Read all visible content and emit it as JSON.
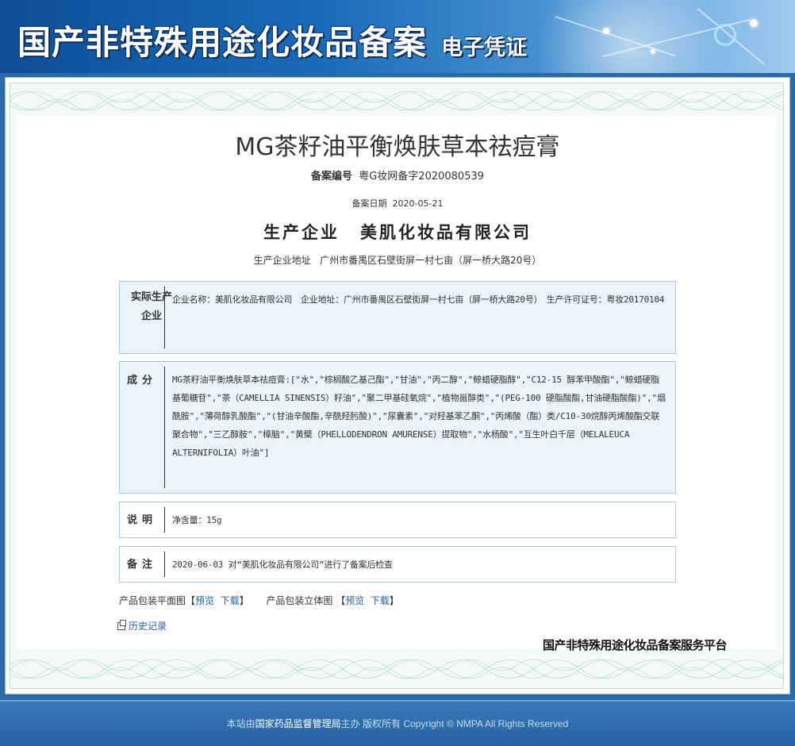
{
  "banner": {
    "title": "国产非特殊用途化妆品备案",
    "subtitle": "电子凭证"
  },
  "product": {
    "title": "MG茶籽油平衡焕肤草本祛痘膏",
    "reg_label": "备案编号",
    "reg_no": "粤G妆网备字2020080539",
    "date_label": "备案日期",
    "date": "2020-05-21",
    "company_label": "生产企业",
    "company": "美肌化妆品有限公司",
    "address_label": "生产企业地址",
    "address": "广州市番禺区石壁街屏一村七亩（屏一桥大路20号）"
  },
  "boxes": {
    "producer": {
      "label": "实际生产企业",
      "text": "企业名称：美肌化妆品有限公司　企业地址：广州市番禺区石壁街屏一村七亩（屏一桥大路20号）　生产许可证号：粤妆20170104"
    },
    "ingredients": {
      "label": "成分",
      "text": "MG茶籽油平衡焕肤草本祛痘膏:[\"水\",\"棕榈酸乙基己酯\",\"甘油\",\"丙二醇\",\"鲸蜡硬脂醇\",\"C12-15 醇苯甲酸酯\",\"鲸蜡硬脂基葡糖苷\",\"茶（CAMELLIA SINENSIS）籽油\",\"聚二甲基硅氧烷\",\"植物甾醇类\",\"(PEG-100 硬脂酸酯,甘油硬脂酸酯)\",\"烟酰胺\",\"薄荷醇乳酸酯\",\"(甘油辛酸酯,辛酰羟肟酸)\",\"尿囊素\",\"对羟基苯乙酮\",\"丙烯酸（酯）类/C10-30烷醇丙烯酸酯交联聚合物\",\"三乙醇胺\",\"樟脑\",\"黄檗（PHELLODENDRON AMURENSE）提取物\",\"水杨酸\",\"互生叶白千层（MELALEUCA ALTERNIFOLIA）叶油\"]"
    },
    "note": {
      "label": "说明",
      "text": "净含量：15g"
    },
    "remark": {
      "label": "备注",
      "text": "2020-06-03 对“美肌化妆品有限公司”进行了备案后检查"
    }
  },
  "links": {
    "flat_label": "产品包装平面图",
    "stereo_label": "产品包装立体图",
    "open_bracket": "【",
    "close_bracket": "】",
    "preview": "预览",
    "download": "下载",
    "history": "历史记录"
  },
  "platform": "国产非特殊用途化妆品备案服务平台",
  "footer": {
    "prefix": "本站由",
    "org": "国家药品监督管理局",
    "suffix": "主办 版权所有 Copyright © NMPA All Rights Reserved"
  }
}
